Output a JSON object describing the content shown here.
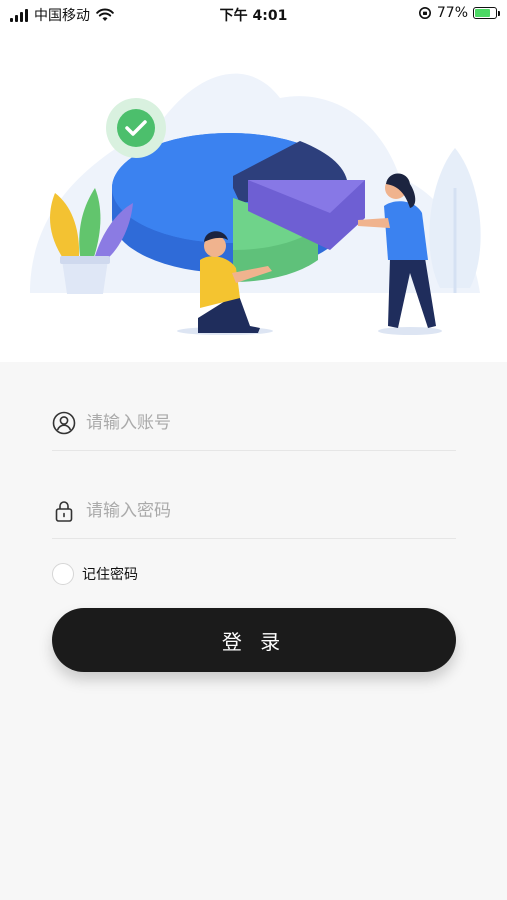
{
  "status_bar": {
    "carrier": "中国移动",
    "time": "下午 4:01",
    "battery_percent": "77%",
    "battery_level": 0.77
  },
  "login_form": {
    "account_placeholder": "请输入账号",
    "password_placeholder": "请输入密码",
    "remember_label": "记住密码",
    "submit_label": "登 录"
  },
  "colors": {
    "button": "#1b1b1b",
    "background": "#f7f7f7",
    "accent_green": "#4cd964"
  }
}
